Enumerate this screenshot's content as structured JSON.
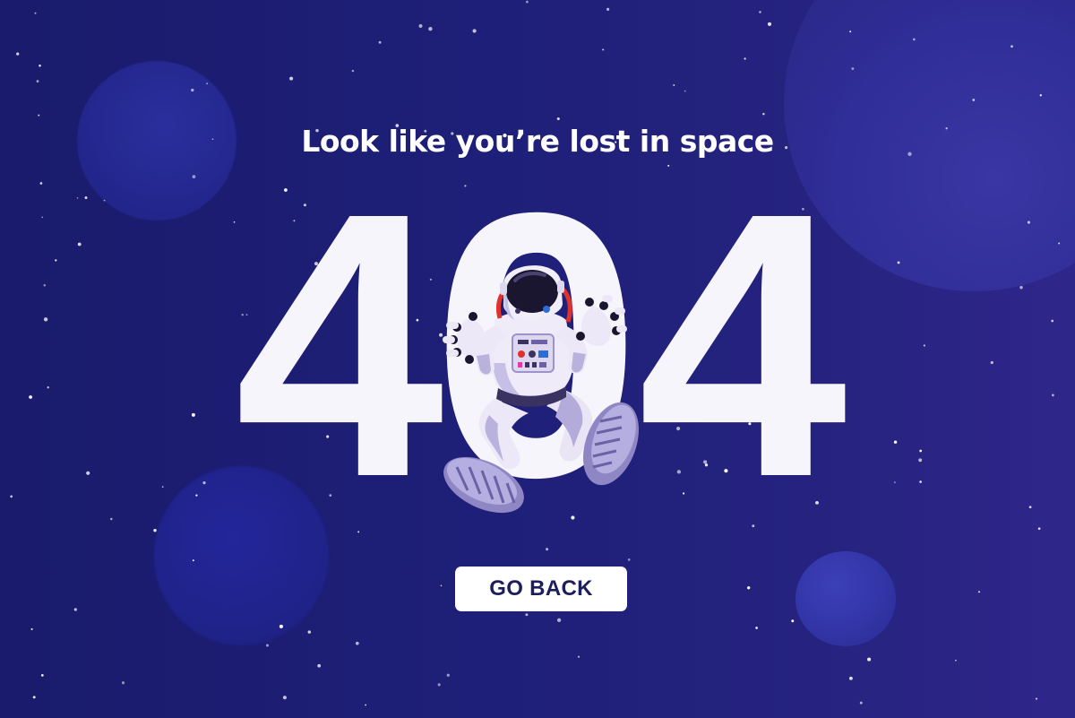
{
  "page": {
    "headline": "Look like you’re lost in space",
    "error_code_left": "4",
    "error_code_middle": "0",
    "error_code_right": "4",
    "button_label": "GO BACK"
  },
  "colors": {
    "background": "#1d1d72",
    "digits": "#f6f5fb",
    "button_bg": "#ffffff",
    "button_text": "#1d1f5c",
    "suit": "#ece8f7",
    "suit_shadow": "#a79fcf",
    "visor": "#1b1630",
    "accent_red": "#e0322b"
  },
  "illustration": {
    "subject": "astronaut-floating"
  }
}
